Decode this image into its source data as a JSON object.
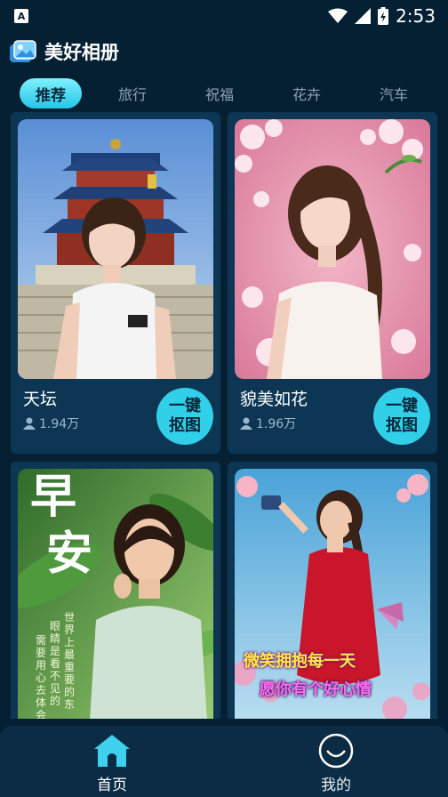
{
  "status_bar": {
    "time": "2:53",
    "app_icon_text": "A"
  },
  "app": {
    "title": "美好相册"
  },
  "tabs": [
    {
      "label": "推荐",
      "active": true
    },
    {
      "label": "旅行",
      "active": false
    },
    {
      "label": "祝福",
      "active": false
    },
    {
      "label": "花卉",
      "active": false
    },
    {
      "label": "汽车",
      "active": false
    }
  ],
  "cards": [
    {
      "title": "天坛",
      "views": "1.94万",
      "button": [
        "一键",
        "抠图"
      ]
    },
    {
      "title": "貌美如花",
      "views": "1.96万",
      "button": [
        "一键",
        "抠图"
      ]
    },
    {
      "overlay_big": [
        "早",
        "安"
      ],
      "overlay_poem_right": "世界上最重要的东",
      "overlay_poem_left": "眼睛是看不见的",
      "overlay_poem_left2": "需要用心去体会"
    },
    {
      "overlay_line1": "微笑拥抱每一天",
      "overlay_line2": "愿你有个好心情"
    }
  ],
  "bottom_nav": [
    {
      "label": "首页",
      "active": true
    },
    {
      "label": "我的",
      "active": false
    }
  ],
  "colors": {
    "background": "#062033",
    "card": "#0c3653",
    "accent": "#32cfe9"
  }
}
